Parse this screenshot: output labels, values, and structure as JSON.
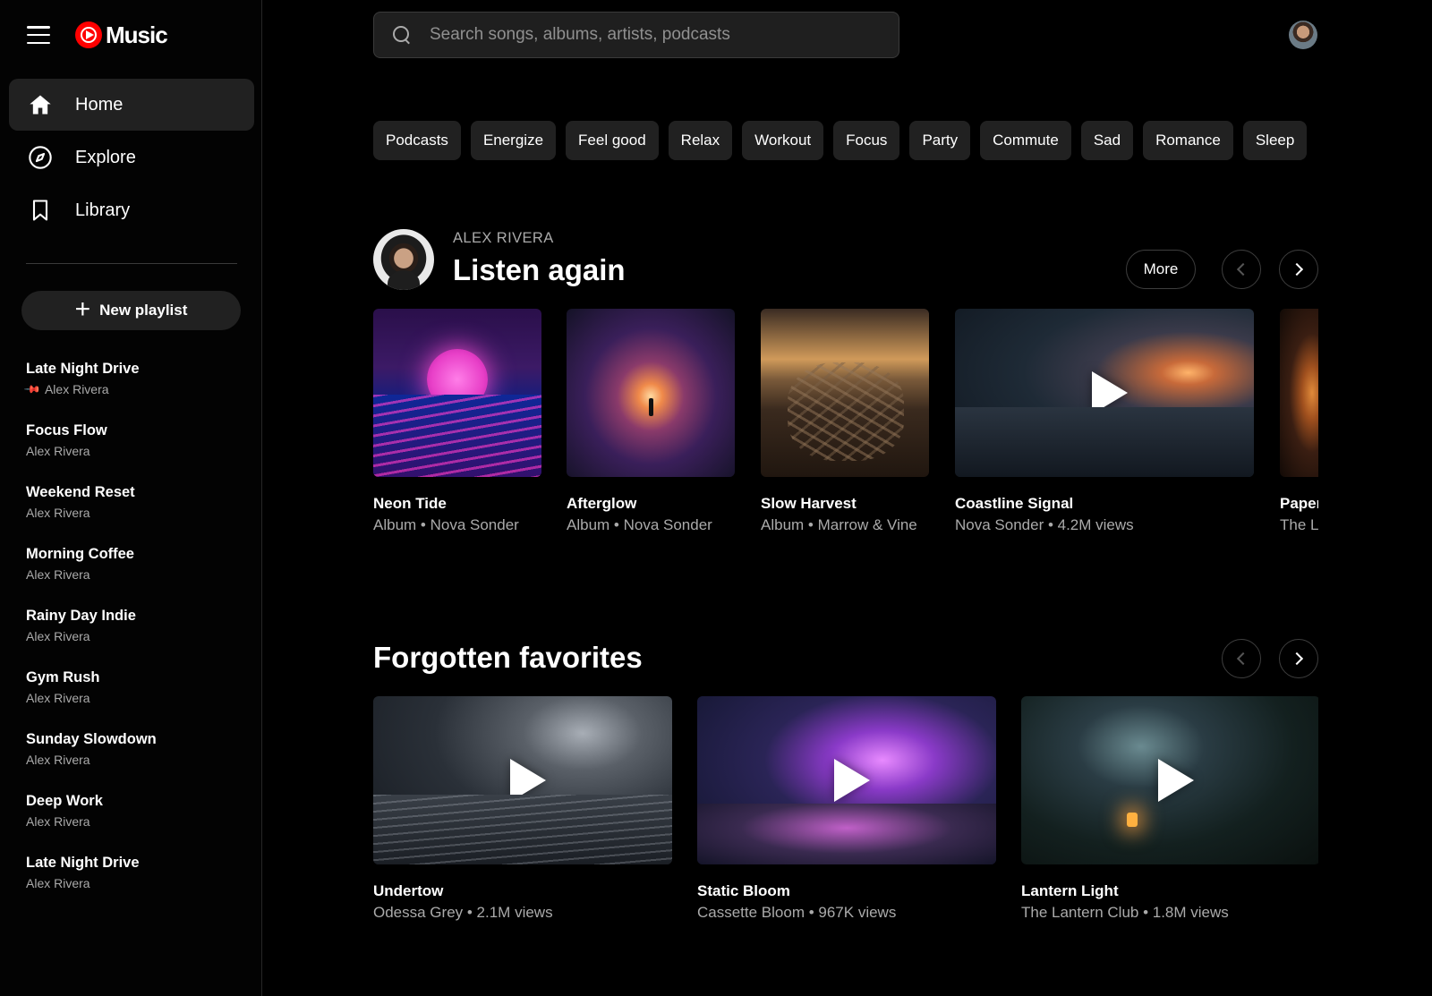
{
  "app": {
    "logo_text": "Music"
  },
  "sidebar": {
    "nav": [
      {
        "label": "Home",
        "icon": "home-icon",
        "active": true
      },
      {
        "label": "Explore",
        "icon": "compass-icon",
        "active": false
      },
      {
        "label": "Library",
        "icon": "bookmark-icon",
        "active": false
      }
    ],
    "new_playlist_label": "New playlist",
    "playlists": [
      {
        "title": "Late Night Drive",
        "owner": "Alex Rivera",
        "pinned": true
      },
      {
        "title": "Focus Flow",
        "owner": "Alex Rivera"
      },
      {
        "title": "Weekend Reset",
        "owner": "Alex Rivera"
      },
      {
        "title": "Morning Coffee",
        "owner": "Alex Rivera"
      },
      {
        "title": "Rainy Day Indie",
        "owner": "Alex Rivera"
      },
      {
        "title": "Gym Rush",
        "owner": "Alex Rivera"
      },
      {
        "title": "Sunday Slowdown",
        "owner": "Alex Rivera"
      },
      {
        "title": "Deep Work",
        "owner": "Alex Rivera"
      },
      {
        "title": "Late Night Drive",
        "owner": "Alex Rivera"
      }
    ]
  },
  "search": {
    "placeholder": "Search songs, albums, artists, podcasts"
  },
  "chips": [
    "Podcasts",
    "Energize",
    "Feel good",
    "Relax",
    "Workout",
    "Focus",
    "Party",
    "Commute",
    "Sad",
    "Romance",
    "Sleep"
  ],
  "listen_again": {
    "kicker": "ALEX RIVERA",
    "title": "Listen again",
    "more_label": "More",
    "items": [
      {
        "title": "Neon Tide",
        "subtitle": "Album • Nova Sonder"
      },
      {
        "title": "Afterglow",
        "subtitle": "Album • Nova Sonder"
      },
      {
        "title": "Slow Harvest",
        "subtitle": "Album • Marrow & Vine"
      },
      {
        "title": "Coastline Signal",
        "subtitle": "Nova Sonder • 4.2M views"
      },
      {
        "title": "Paper Lanterns",
        "subtitle": "The Lantern Club"
      }
    ]
  },
  "forgotten_favorites": {
    "title": "Forgotten favorites",
    "items": [
      {
        "title": "Undertow",
        "subtitle": "Odessa Grey • 2.1M views"
      },
      {
        "title": "Static Bloom",
        "subtitle": "Cassette Bloom • 967K views"
      },
      {
        "title": "Lantern Light",
        "subtitle": "The Lantern Club • 1.8M views"
      }
    ]
  },
  "colors": {
    "accent": "#ff0000",
    "background": "#000000",
    "surface": "#212121",
    "text_secondary": "#aaaaaa"
  }
}
